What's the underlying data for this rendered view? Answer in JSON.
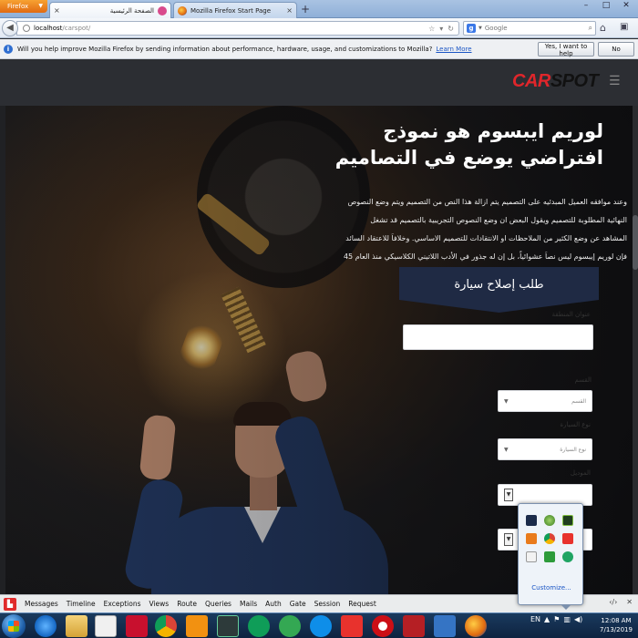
{
  "browser": {
    "app_button": "Firefox",
    "tabs": [
      {
        "label": "الصفحة الرئيسية",
        "active": true
      },
      {
        "label": "Mozilla Firefox Start Page",
        "active": false
      }
    ],
    "url": {
      "host": "localhost",
      "path": "/carspot/"
    },
    "search": {
      "engine": "Google",
      "placeholder": "Google"
    }
  },
  "notification": {
    "text": "Will you help improve Mozilla Firefox by sending information about performance, hardware, usage, and customizations to Mozilla?",
    "link": "Learn More",
    "yes_label": "Yes, I want to help",
    "no_label": "No"
  },
  "site": {
    "logo_car": "CAR",
    "logo_spot": "SPOT",
    "colors": {
      "brand_red": "#e0262b",
      "form_header": "#1f2a44"
    },
    "hero_title": "لوريم ايبسوم هو نموذج افتراضي يوضع في التصاميم",
    "hero_lines": [
      "وعند موافقه العميل المبدئيه على التصميم يتم ازالة هذا النص من التصميم ويتم وضع النصوص",
      "النهائية المطلوبة للتصميم ويقول البعض ان وضع النصوص التجريبية بالتصميم قد تشغل",
      "المشاهد عن وضع الكثير من الملاحظات او الانتقادات للتصميم الاساسي. وخلافاَ للاعتقاد السائد",
      "فإن لوريم إيبسوم ليس نصاَ عشوائياً، بل إن له جذور في الأدب اللاتيني الكلاسيكي منذ العام 45"
    ]
  },
  "form": {
    "title": "طلب إصلاح سيارة",
    "address_label": "عنوان المنطقة",
    "section_label": "القسم",
    "section_value": "القسم",
    "car_type_label": "نوع السيارة",
    "car_type_value": "نوع السيارة",
    "model_label": "الموديل"
  },
  "devbar": {
    "items": [
      "Messages",
      "Timeline",
      "Exceptions",
      "Views",
      "Route",
      "Queries",
      "Mails",
      "Auth",
      "Gate",
      "Session",
      "Request"
    ]
  },
  "tray": {
    "customize": "Customize...",
    "language": "EN",
    "time": "12:08 AM",
    "date": "7/13/2019"
  }
}
